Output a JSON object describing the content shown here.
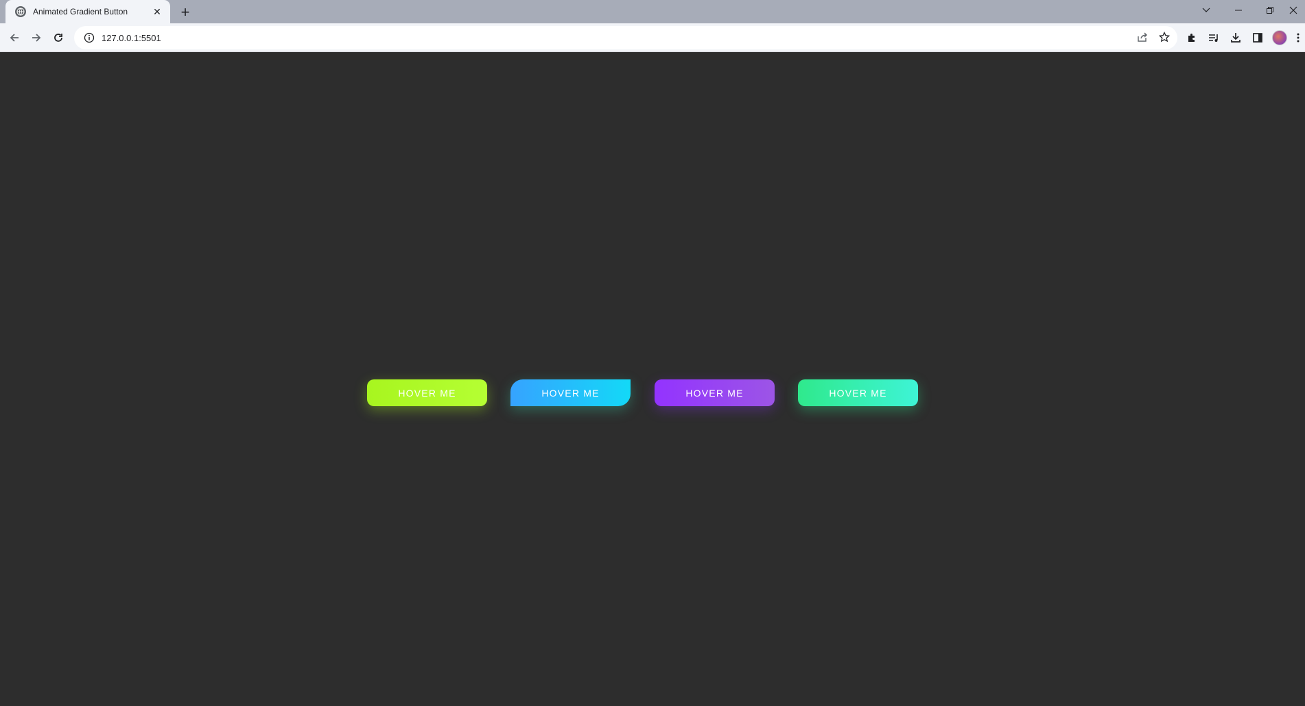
{
  "browser": {
    "tab": {
      "title": "Animated Gradient Button",
      "favicon": "globe-icon",
      "close_label": "✕"
    },
    "new_tab_label": "+",
    "address": {
      "url": "127.0.0.1:5501"
    },
    "icons": {
      "back": "back-arrow-icon",
      "forward": "forward-arrow-icon",
      "reload": "reload-icon",
      "info": "info-icon",
      "share": "share-icon",
      "bookmark": "star-icon",
      "extensions": "puzzle-icon",
      "media": "media-queue-icon",
      "download": "download-icon",
      "sidepanel": "side-panel-icon",
      "profile": "avatar",
      "menu": "kebab-menu-icon"
    },
    "window_controls": {
      "tab_search": "chevron-down-icon",
      "minimize": "minimize-icon",
      "restore": "restore-icon",
      "close": "close-icon"
    }
  },
  "page": {
    "background": "#2d2d2d",
    "buttons": [
      {
        "label": "HOVER ME",
        "gradient": [
          "#a8f51f",
          "#b5ff33"
        ]
      },
      {
        "label": "HOVER ME",
        "gradient": [
          "#36a3ff",
          "#13d9f7"
        ]
      },
      {
        "label": "HOVER ME",
        "gradient": [
          "#9333ff",
          "#9c55e6"
        ]
      },
      {
        "label": "HOVER ME",
        "gradient": [
          "#2fe98c",
          "#3ef4d6"
        ]
      }
    ]
  }
}
